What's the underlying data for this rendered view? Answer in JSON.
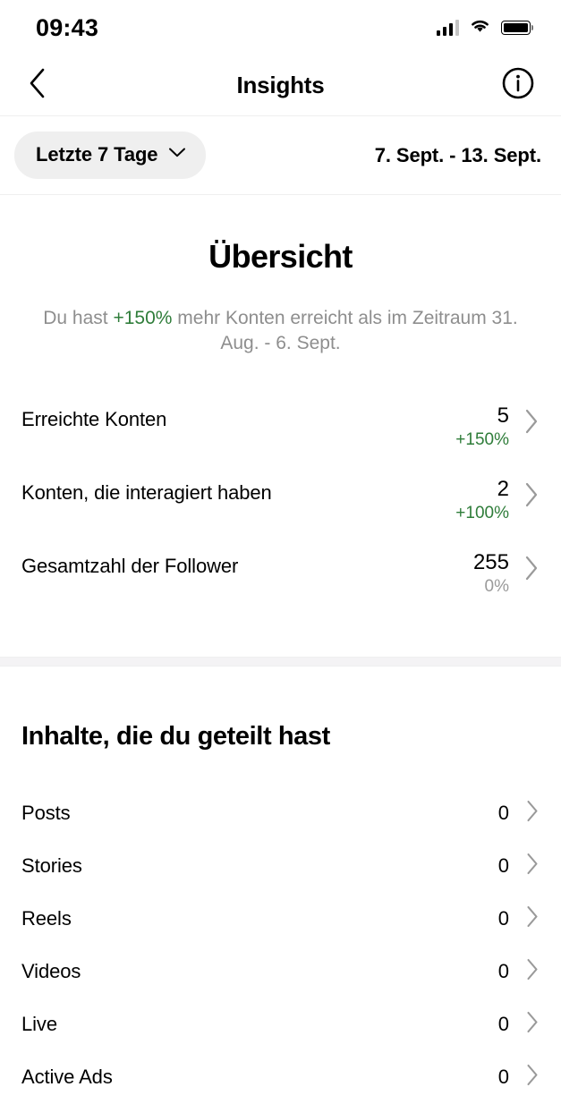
{
  "statusbar": {
    "time": "09:43",
    "icons": [
      "signal-icon",
      "wifi-icon",
      "battery-icon"
    ]
  },
  "header": {
    "back_icon": "chevron-left-icon",
    "title": "Insights",
    "info_icon": "info-circle-icon"
  },
  "filterbar": {
    "range_label": "Letzte 7 Tage",
    "range_chevron": "chevron-down-icon",
    "date_range": "7. Sept. - 13. Sept."
  },
  "overview": {
    "title": "Übersicht",
    "subtitle_before": "Du hast ",
    "subtitle_highlight": "+150%",
    "subtitle_after": " mehr Konten erreicht als im Zeitraum 31. Aug. - 6. Sept.",
    "metrics": [
      {
        "label": "Erreichte Konten",
        "value": "5",
        "delta": "+150%",
        "delta_state": "up"
      },
      {
        "label": "Konten, die interagiert haben",
        "value": "2",
        "delta": "+100%",
        "delta_state": "up"
      },
      {
        "label": "Gesamtzahl der Follower",
        "value": "255",
        "delta": "0%",
        "delta_state": "flat"
      }
    ]
  },
  "content": {
    "title": "Inhalte, die du geteilt hast",
    "rows": [
      {
        "label": "Posts",
        "value": "0"
      },
      {
        "label": "Stories",
        "value": "0"
      },
      {
        "label": "Reels",
        "value": "0"
      },
      {
        "label": "Videos",
        "value": "0"
      },
      {
        "label": "Live",
        "value": "0"
      },
      {
        "label": "Active Ads",
        "value": "0"
      }
    ]
  },
  "colors": {
    "positive_green": "#2f7d3a",
    "muted_gray": "#8e8e8e",
    "pill_bg": "#efefef",
    "divider": "#f4f3f5"
  }
}
